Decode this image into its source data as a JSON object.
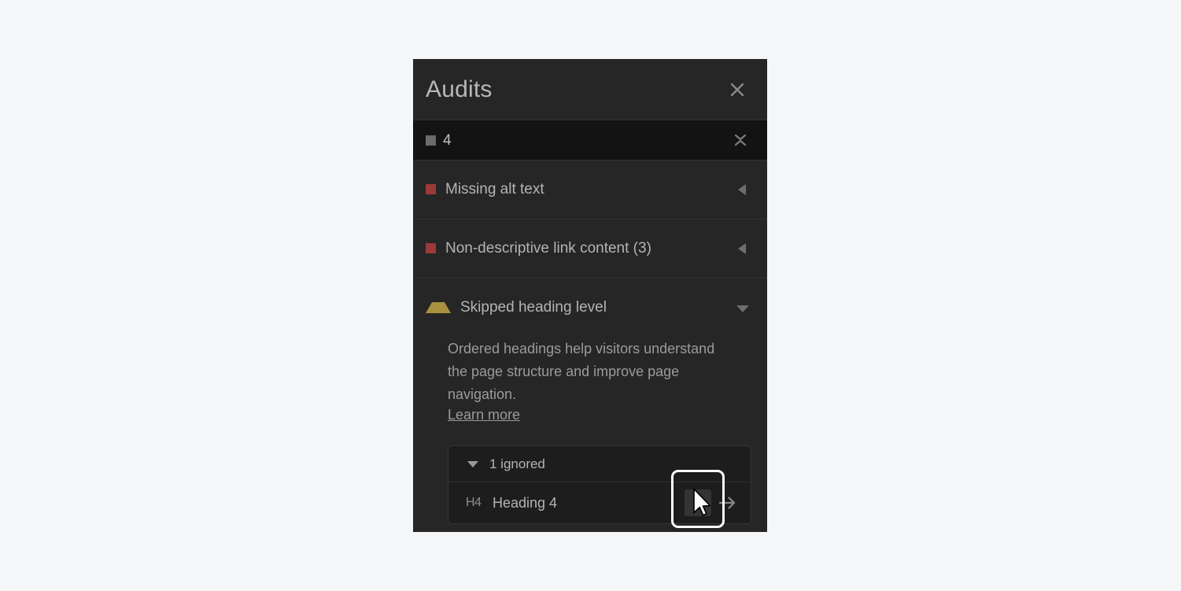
{
  "panel": {
    "title": "Audits",
    "close_icon": "close-icon"
  },
  "summary": {
    "indicator": "gray-square-icon",
    "count": "4",
    "collapse_all_icon": "collapse-all-icon"
  },
  "audits": [
    {
      "indicator": "red-square-icon",
      "label": "Missing alt text",
      "caret_icon": "caret-left-icon",
      "expanded": false
    },
    {
      "indicator": "red-square-icon",
      "label": "Non-descriptive link content (3)",
      "caret_icon": "caret-left-icon",
      "expanded": false
    },
    {
      "indicator": "warning-triangle-icon",
      "label": "Skipped heading level",
      "caret_icon": "caret-down-icon",
      "expanded": true,
      "description": "Ordered headings help visitors understand the page structure and improve page navigation.",
      "learn_more": "Learn more",
      "ignored_group": {
        "caret_icon": "caret-down-icon",
        "label": "1 ignored",
        "items": [
          {
            "tag": "H4",
            "label": "Heading 4",
            "bell_icon": "bell-icon",
            "goto_icon": "arrow-right-icon"
          }
        ]
      }
    }
  ],
  "colors": {
    "page_background": "#f4f6f7",
    "panel_background": "#262626",
    "summary_background": "#131313",
    "error_indicator": "#9c3a3a",
    "warning_indicator": "#a8903f",
    "neutral_indicator": "#6b6b6b",
    "text_primary": "#b4b4b4",
    "text_secondary": "#9b9b9b",
    "focus_outline": "#ffffff"
  }
}
